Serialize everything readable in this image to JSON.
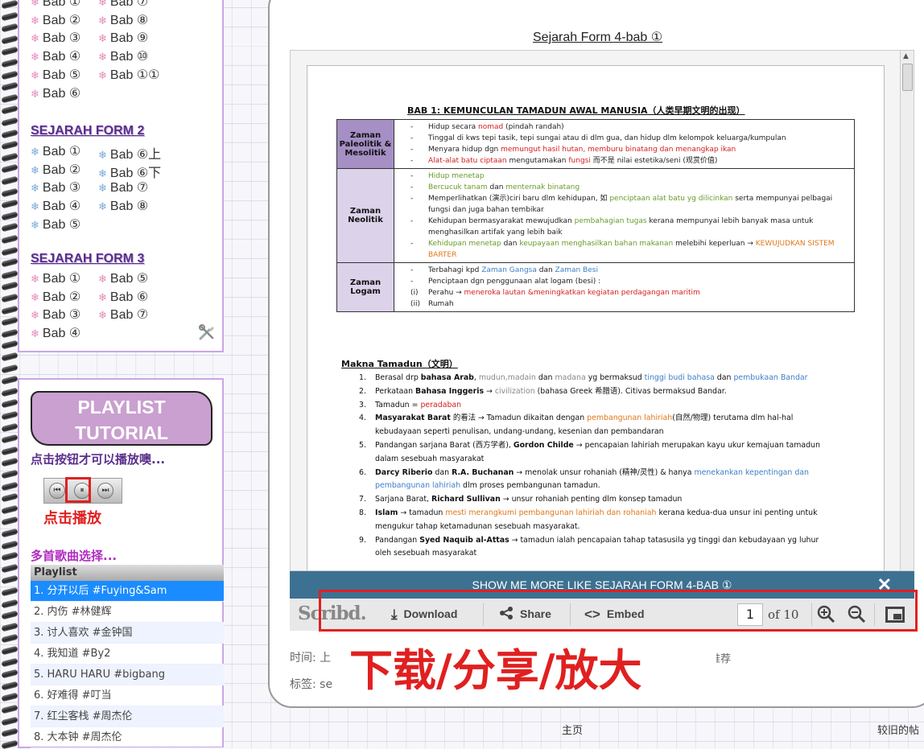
{
  "sidebar": {
    "form1_items": [
      "Bab ①",
      "Bab ⑦",
      "Bab ②",
      "Bab ⑧",
      "Bab ③",
      "Bab ⑨",
      "Bab ④",
      "Bab ⑩",
      "Bab ⑤",
      "Bab ①①",
      "Bab ⑥"
    ],
    "form2_title": "SEJARAH FORM 2",
    "form2_items": [
      "Bab ①",
      "Bab ⑥上",
      "Bab ②",
      "Bab ⑥下",
      "Bab ③",
      "Bab ⑦",
      "Bab ④",
      "Bab ⑧",
      "Bab ⑤"
    ],
    "form3_title": "SEJARAH FORM 3",
    "form3_items": [
      "Bab ①",
      "Bab ⑤",
      "Bab ②",
      "Bab ⑥",
      "Bab ③",
      "Bab ⑦",
      "Bab ④"
    ]
  },
  "player": {
    "button_line1": "PLAYLIST",
    "button_line2": "TUTORIAL",
    "click_hint": "点击按钮才可以播放噢...",
    "play_hint": "点击播放",
    "songs_hint": "多首歌曲选择...",
    "playlist_header": "Playlist",
    "songs": [
      "1. 分开以后 #Fuying&Sam",
      "2. 内伤 #林健辉",
      "3. 讨人喜欢 #金钟国",
      "4. 我知道 #By2",
      "5. HARU HARU #bigbang",
      "6. 好难得 #叮当",
      "7. 红尘客栈 #周杰伦",
      "8. 大本钟 #周杰伦"
    ]
  },
  "doc": {
    "title": "Sejarah Form 4-bab ①",
    "heading": "BAB 1:  KEMUNCULAN TAMADUN AWAL MANUSIA（人类早期文明的出现）",
    "eras": [
      {
        "name": "Zaman Paleolitik & Mesolitik",
        "lines": [
          {
            "d": "-",
            "parts": [
              [
                "Hidup secara ",
                ""
              ],
              [
                "nomad",
                "red"
              ],
              [
                " (pindah randah)",
                ""
              ]
            ]
          },
          {
            "d": "-",
            "parts": [
              [
                "Tinggal di kws tepi tasik, tepi sungai atau di dlm gua, dan hidup dlm kelompok keluarga/kumpulan",
                ""
              ]
            ]
          },
          {
            "d": "-",
            "parts": [
              [
                "Menyara hidup dgn ",
                ""
              ],
              [
                "memungut hasil hutan, memburu binatang dan menangkap ikan",
                "red"
              ]
            ]
          },
          {
            "d": "-",
            "parts": [
              [
                "Alat-alat batu ciptaan",
                "red"
              ],
              [
                " mengutamakan ",
                ""
              ],
              [
                "fungsi",
                "red"
              ],
              [
                " 而不是 nilai estetika/seni (观赏价值)",
                ""
              ]
            ]
          }
        ]
      },
      {
        "name": "Zaman Neolitik",
        "lines": [
          {
            "d": "-",
            "parts": [
              [
                "Hidup menetap",
                "green"
              ]
            ]
          },
          {
            "d": "-",
            "parts": [
              [
                "Bercucuk tanam",
                "green"
              ],
              [
                " dan ",
                ""
              ],
              [
                "menternak binatang",
                "green"
              ]
            ]
          },
          {
            "d": "-",
            "parts": [
              [
                "Memperlihatkan (演示)ciri baru dlm kehidupan, 如 ",
                ""
              ],
              [
                "penciptaan alat batu yg dilicinkan",
                "green"
              ],
              [
                " serta mempunyai pelbagai fungsi dan juga bahan tembikar",
                ""
              ]
            ]
          },
          {
            "d": "-",
            "parts": [
              [
                "Kehidupan bermasyarakat mewujudkan ",
                ""
              ],
              [
                "pembahagian tugas",
                "green"
              ],
              [
                " kerana mempunyai lebih banyak masa untuk menghasilkan artifak yang lebih baik",
                ""
              ]
            ]
          },
          {
            "d": "-",
            "parts": [
              [
                "Kehidupan menetap",
                "green"
              ],
              [
                " dan ",
                ""
              ],
              [
                "keupayaan menghasilkan bahan makanan",
                "green"
              ],
              [
                " melebihi keperluan → ",
                ""
              ],
              [
                "KEWUJUDKAN SISTEM BARTER",
                "orange"
              ]
            ]
          }
        ]
      },
      {
        "name": "Zaman Logam",
        "lines": [
          {
            "d": "-",
            "parts": [
              [
                "Terbahagi kpd ",
                ""
              ],
              [
                "Zaman Gangsa",
                "blue"
              ],
              [
                " dan ",
                ""
              ],
              [
                "Zaman Besi",
                "blue"
              ]
            ]
          },
          {
            "d": "-",
            "parts": [
              [
                "Penciptaan dgn penggunaan alat logam (besi) :",
                ""
              ]
            ]
          },
          {
            "d": "(i)",
            "parts": [
              [
                "Perahu → ",
                ""
              ],
              [
                "meneroka lautan &meningkatkan kegiatan perdagangan maritim",
                "red"
              ]
            ]
          },
          {
            "d": "(ii)",
            "parts": [
              [
                "Rumah",
                ""
              ]
            ]
          }
        ]
      }
    ],
    "makna_heading": "Makna Tamadun（文明）",
    "makna": [
      {
        "n": "1.",
        "parts": [
          [
            "Berasal drp ",
            ""
          ],
          [
            "bahasa Arab",
            "bold"
          ],
          [
            ", ",
            ""
          ],
          [
            "mudun,madain",
            "grey"
          ],
          [
            " dan ",
            ""
          ],
          [
            "madana",
            "grey"
          ],
          [
            " yg bermaksud ",
            ""
          ],
          [
            "tinggi budi bahasa",
            "blue"
          ],
          [
            " dan ",
            ""
          ],
          [
            "pembukaan Bandar",
            "blue"
          ]
        ]
      },
      {
        "n": "2.",
        "parts": [
          [
            "Perkataan ",
            ""
          ],
          [
            "Bahasa Inggeris",
            "bold"
          ],
          [
            " → ",
            ""
          ],
          [
            "civilization",
            "grey"
          ],
          [
            " (bahasa Greek 希腊语). Citivas bermaksud Bandar.",
            ""
          ]
        ]
      },
      {
        "n": "3.",
        "parts": [
          [
            "Tamadun = ",
            ""
          ],
          [
            "peradaban",
            "red"
          ]
        ]
      },
      {
        "n": "4.",
        "parts": [
          [
            "Masyarakat Barat",
            "bold"
          ],
          [
            " 的看法 → Tamadun dikaitan dengan ",
            ""
          ],
          [
            "pembangunan lahiriah",
            "orange"
          ],
          [
            "(自然/物理) terutama dlm hal-hal kebudayaan seperti penulisan, undang-undang, kesenian dan pembandaran",
            ""
          ]
        ]
      },
      {
        "n": "5.",
        "parts": [
          [
            "Pandangan sarjana Barat (西方学者), ",
            ""
          ],
          [
            "Gordon Childe",
            "bold"
          ],
          [
            " → pencapaian lahiriah merupakan kayu ukur kemajuan tamadun dalam sesebuah masyarakat",
            ""
          ]
        ]
      },
      {
        "n": "6.",
        "parts": [
          [
            "Darcy Riberio",
            "bold"
          ],
          [
            " dan ",
            ""
          ],
          [
            "R.A. Buchanan",
            "bold"
          ],
          [
            " → menolak unsur rohaniah (精神/灵性) & hanya ",
            ""
          ],
          [
            "menekankan kepentingan dan pembangunan lahiriah",
            "blue"
          ],
          [
            " dlm proses pembangunan tamadun.",
            ""
          ]
        ]
      },
      {
        "n": "7.",
        "parts": [
          [
            "Sarjana Barat, ",
            ""
          ],
          [
            "Richard Sullivan",
            "bold"
          ],
          [
            " → unsur rohaniah penting dlm konsep tamadun",
            ""
          ]
        ]
      },
      {
        "n": "8.",
        "parts": [
          [
            "Islam",
            "bold"
          ],
          [
            " → tamadun ",
            ""
          ],
          [
            "mesti merangkumi pembangunan lahiriah dan rohaniah",
            "orange"
          ],
          [
            " kerana kedua-dua unsur ini penting untuk mengukur tahap ketamadunan sesebuah masyarakat.",
            ""
          ]
        ]
      },
      {
        "n": "9.",
        "parts": [
          [
            "Pandangan ",
            ""
          ],
          [
            "Syed Naquib al-Attas",
            "bold"
          ],
          [
            " → tamadun ialah pencapaian tahap tatasusila yg tinggi dan kebudayaan yg luhur oleh sesebuah masyarakat",
            ""
          ]
        ]
      }
    ]
  },
  "viewer": {
    "more_label": "SHOW ME MORE LIKE SEJARAH FORM 4-BAB ①",
    "close_label": "✕",
    "logo": "Scribd.",
    "download": "Download",
    "share": "Share",
    "embed": "Embed",
    "page": "1",
    "of_pages": "of 10"
  },
  "meta": {
    "time_label": "时间: 上",
    "tags_label": "标签: se",
    "recommend": "推荐",
    "overlay_caption": "下载/分享/放大"
  },
  "footer": {
    "home": "主页",
    "older": "较旧的帖"
  },
  "colors": {
    "accent_purple": "#c9a6e6",
    "highlight_red": "#e02020",
    "scribd_bar_blue": "#3c7192"
  }
}
